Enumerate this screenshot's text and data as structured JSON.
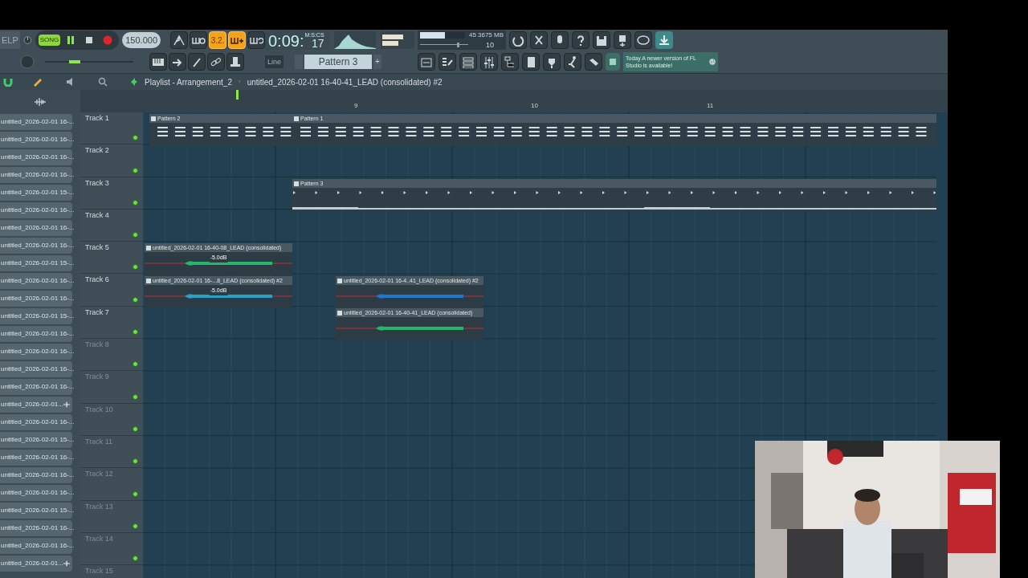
{
  "toolbar": {
    "help_label": "ELP",
    "transport": {
      "mode": "SONG",
      "playing": true
    },
    "tempo": "150.000",
    "toggles": [
      {
        "kind": "metronome",
        "on": false
      },
      {
        "kind": "wait",
        "on": false
      },
      {
        "kind": "countdown",
        "label": "3.2.",
        "on": true
      },
      {
        "kind": "overdub",
        "on": true
      },
      {
        "kind": "loop",
        "on": false
      }
    ],
    "time": {
      "value": "0:09:",
      "centis": "17",
      "unit": "M:S:CS"
    },
    "cpu": {
      "level": 0.55,
      "reading": "45"
    },
    "memory": "3675 MB",
    "polyphony": "10",
    "snap": "Line",
    "pattern": {
      "name": "Pattern 3",
      "add": "+"
    },
    "news": {
      "when": "Today",
      "text": "A newer version of FL Studio is available!"
    }
  },
  "breadcrumb": {
    "title": "Playlist - Arrangement_2",
    "separator": "›",
    "clip": "untitled_2026-02-01 16-40-41_LEAD (consolidated) #2"
  },
  "browser": {
    "items": [
      {
        "label": "untitled_2026-02-01 16-..."
      },
      {
        "label": "untitled_2026-02-01 16-..."
      },
      {
        "label": "untitled_2026-02-01 16-..."
      },
      {
        "label": "untitled_2026-02-01 16-..."
      },
      {
        "label": "untitled_2026-02-01 15-..."
      },
      {
        "label": "untitled_2026-02-01 16-..."
      },
      {
        "label": "untitled_2026-02-01 16-..."
      },
      {
        "label": "untitled_2026-02-01 16-..."
      },
      {
        "label": "untitled_2026-02-01 15-..."
      },
      {
        "label": "untitled_2026-02-01 16-..."
      },
      {
        "label": "untitled_2026-02-01 16-..."
      },
      {
        "label": "untitled_2026-02-01 15-..."
      },
      {
        "label": "untitled_2026-02-01 16-..."
      },
      {
        "label": "untitled_2026-02-01 16-..."
      },
      {
        "label": "untitled_2026-02-01 16-..."
      },
      {
        "label": "untitled_2026-02-01 16-..."
      },
      {
        "label": "untitled_2026-02-01...",
        "selected": true
      },
      {
        "label": "untitled_2026-02-01 16-..."
      },
      {
        "label": "untitled_2026-02-01 15-..."
      },
      {
        "label": "untitled_2026-02-01 16-..."
      },
      {
        "label": "untitled_2026-02-01 16-..."
      },
      {
        "label": "untitled_2026-02-01 16-..."
      },
      {
        "label": "untitled_2026-02-01 15-..."
      },
      {
        "label": "untitled_2026-02-01 16-..."
      },
      {
        "label": "untitled_2026-02-01 16-..."
      },
      {
        "label": "untitled_2026-02-01...",
        "selected": true
      }
    ]
  },
  "ruler": [
    "9",
    "10",
    "11"
  ],
  "tracks": [
    {
      "name": "Track 1",
      "used": true
    },
    {
      "name": "Track 2",
      "used": true
    },
    {
      "name": "Track 3",
      "used": true
    },
    {
      "name": "Track 4",
      "used": true
    },
    {
      "name": "Track 5",
      "used": true
    },
    {
      "name": "Track 6",
      "used": true
    },
    {
      "name": "Track 7",
      "used": true
    },
    {
      "name": "Track 8",
      "used": false
    },
    {
      "name": "Track 9",
      "used": false
    },
    {
      "name": "Track 10",
      "used": false
    },
    {
      "name": "Track 11",
      "used": false
    },
    {
      "name": "Track 12",
      "used": false
    },
    {
      "name": "Track 13",
      "used": false
    },
    {
      "name": "Track 14",
      "used": false
    },
    {
      "name": "Track 15",
      "used": false
    }
  ],
  "clips": [
    {
      "kind": "notes",
      "label": "Pattern 2"
    },
    {
      "kind": "notes",
      "label": "Pattern 1"
    },
    {
      "kind": "line",
      "label": "Pattern 3"
    },
    {
      "kind": "audio",
      "label": "untitled_2026-02-01 16-40-08_LEAD (consolidated)",
      "gain": "-5.0dB",
      "color": "#22b86a"
    },
    {
      "kind": "audio",
      "label": "untitled_2026-02-01 16-...8_LEAD (consolidated) #2",
      "gain": "-5.0dB",
      "color": "#2a9fc8"
    },
    {
      "kind": "audio",
      "label": "untitled_2026-02-01 16-4..41_LEAD (consolidated) #2",
      "color": "#1e78d0"
    },
    {
      "kind": "audio",
      "label": "untitled_2026-02-01 16-40-41_LEAD (consolidated)",
      "color": "#22b86a"
    }
  ]
}
